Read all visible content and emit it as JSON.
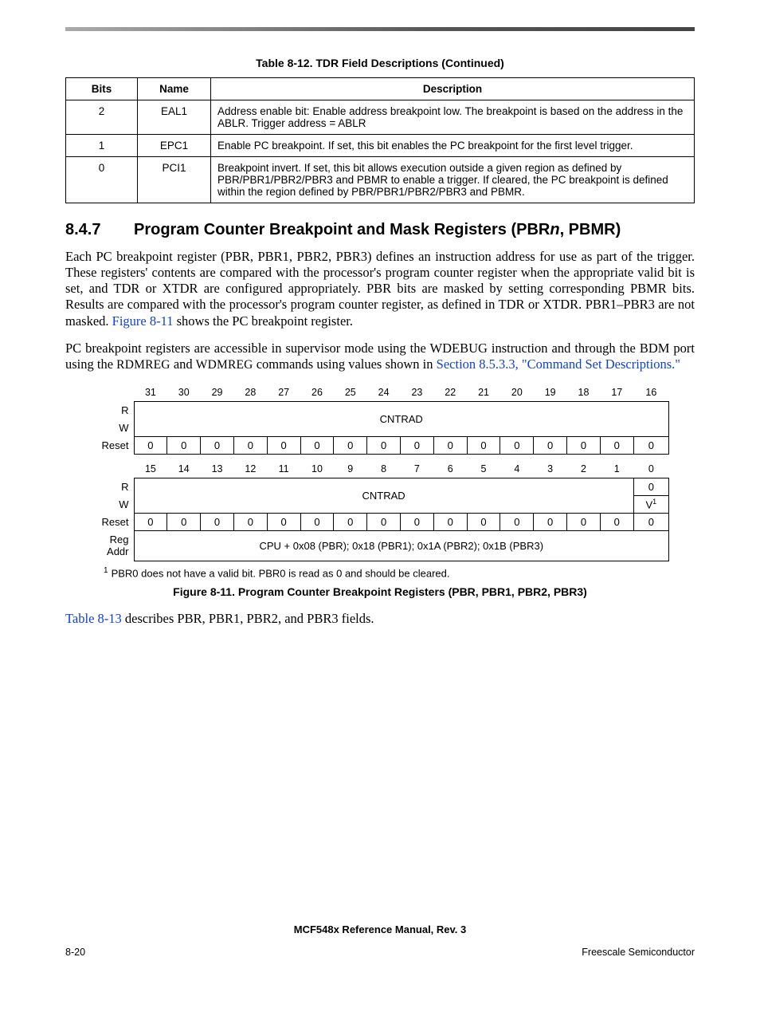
{
  "table_caption": "Table 8-12. TDR Field Descriptions (Continued)",
  "fields_table": {
    "headers": {
      "bits": "Bits",
      "name": "Name",
      "desc": "Description"
    },
    "rows": [
      {
        "bits": "2",
        "name": "EAL1",
        "desc": "Address enable bit: Enable address breakpoint low. The breakpoint is based on the address in the ABLR. Trigger address = ABLR"
      },
      {
        "bits": "1",
        "name": "EPC1",
        "desc": "Enable PC breakpoint. If set, this bit enables the PC breakpoint for the first level trigger."
      },
      {
        "bits": "0",
        "name": "PCI1",
        "desc": "Breakpoint invert. If set, this bit allows execution outside a given region as defined by PBR/PBR1/PBR2/PBR3 and PBMR to enable a trigger. If cleared, the PC breakpoint is defined within the region defined by PBR/PBR1/PBR2/PBR3 and PBMR."
      }
    ]
  },
  "section": {
    "num": "8.4.7",
    "title_a": "Program Counter Breakpoint and Mask Registers (PBR",
    "title_ital": "n",
    "title_b": ", PBMR)"
  },
  "para1_a": "Each PC breakpoint register (PBR, PBR1, PBR2, PBR3) defines an instruction address for use as part of the trigger. These registers' contents are compared with the processor's program counter register when the appropriate valid bit is set, and TDR or XTDR are configured appropriately. PBR bits are masked by setting corresponding PBMR bits. Results are compared with the processor's program counter register, as defined in TDR or XTDR. PBR1–PBR3 are not masked. ",
  "para1_link": "Figure 8-11",
  "para1_b": " shows the PC breakpoint register.",
  "para2_a": "PC breakpoint registers are accessible in supervisor mode using the WDEBUG instruction and through the BDM port using the ",
  "para2_sc1": "RDMREG",
  "para2_mid": " and ",
  "para2_sc2": "WDMREG",
  "para2_b": " commands using values shown in ",
  "para2_link": "Section 8.5.3.3, \"Command Set Descriptions.\"",
  "reg": {
    "bits_hi": [
      "31",
      "30",
      "29",
      "28",
      "27",
      "26",
      "25",
      "24",
      "23",
      "22",
      "21",
      "20",
      "19",
      "18",
      "17",
      "16"
    ],
    "bits_lo": [
      "15",
      "14",
      "13",
      "12",
      "11",
      "10",
      "9",
      "8",
      "7",
      "6",
      "5",
      "4",
      "3",
      "2",
      "1",
      "0"
    ],
    "row_labels": {
      "r": "R",
      "w": "W",
      "reset": "Reset",
      "regaddr1": "Reg",
      "regaddr2": "Addr"
    },
    "cntrad": "CNTRAD",
    "reset_vals": [
      "0",
      "0",
      "0",
      "0",
      "0",
      "0",
      "0",
      "0",
      "0",
      "0",
      "0",
      "0",
      "0",
      "0",
      "0",
      "0"
    ],
    "lo_last_r": "0",
    "lo_last_w": "V",
    "lo_last_w_sup": "1",
    "regaddr_text": "CPU + 0x08 (PBR); 0x18 (PBR1); 0x1A (PBR2); 0x1B (PBR3)"
  },
  "footnote_num": "1",
  "footnote_text": "PBR0 does not have a valid bit. PBR0 is read as 0 and should be cleared.",
  "figure_caption": "Figure 8-11. Program Counter Breakpoint Registers (PBR, PBR1, PBR2, PBR3)",
  "post_fig_link": "Table 8-13",
  "post_fig_text": " describes PBR, PBR1, PBR2, and PBR3 fields.",
  "footer_center": "MCF548x Reference Manual, Rev. 3",
  "footer_left": "8-20",
  "footer_right": "Freescale Semiconductor"
}
